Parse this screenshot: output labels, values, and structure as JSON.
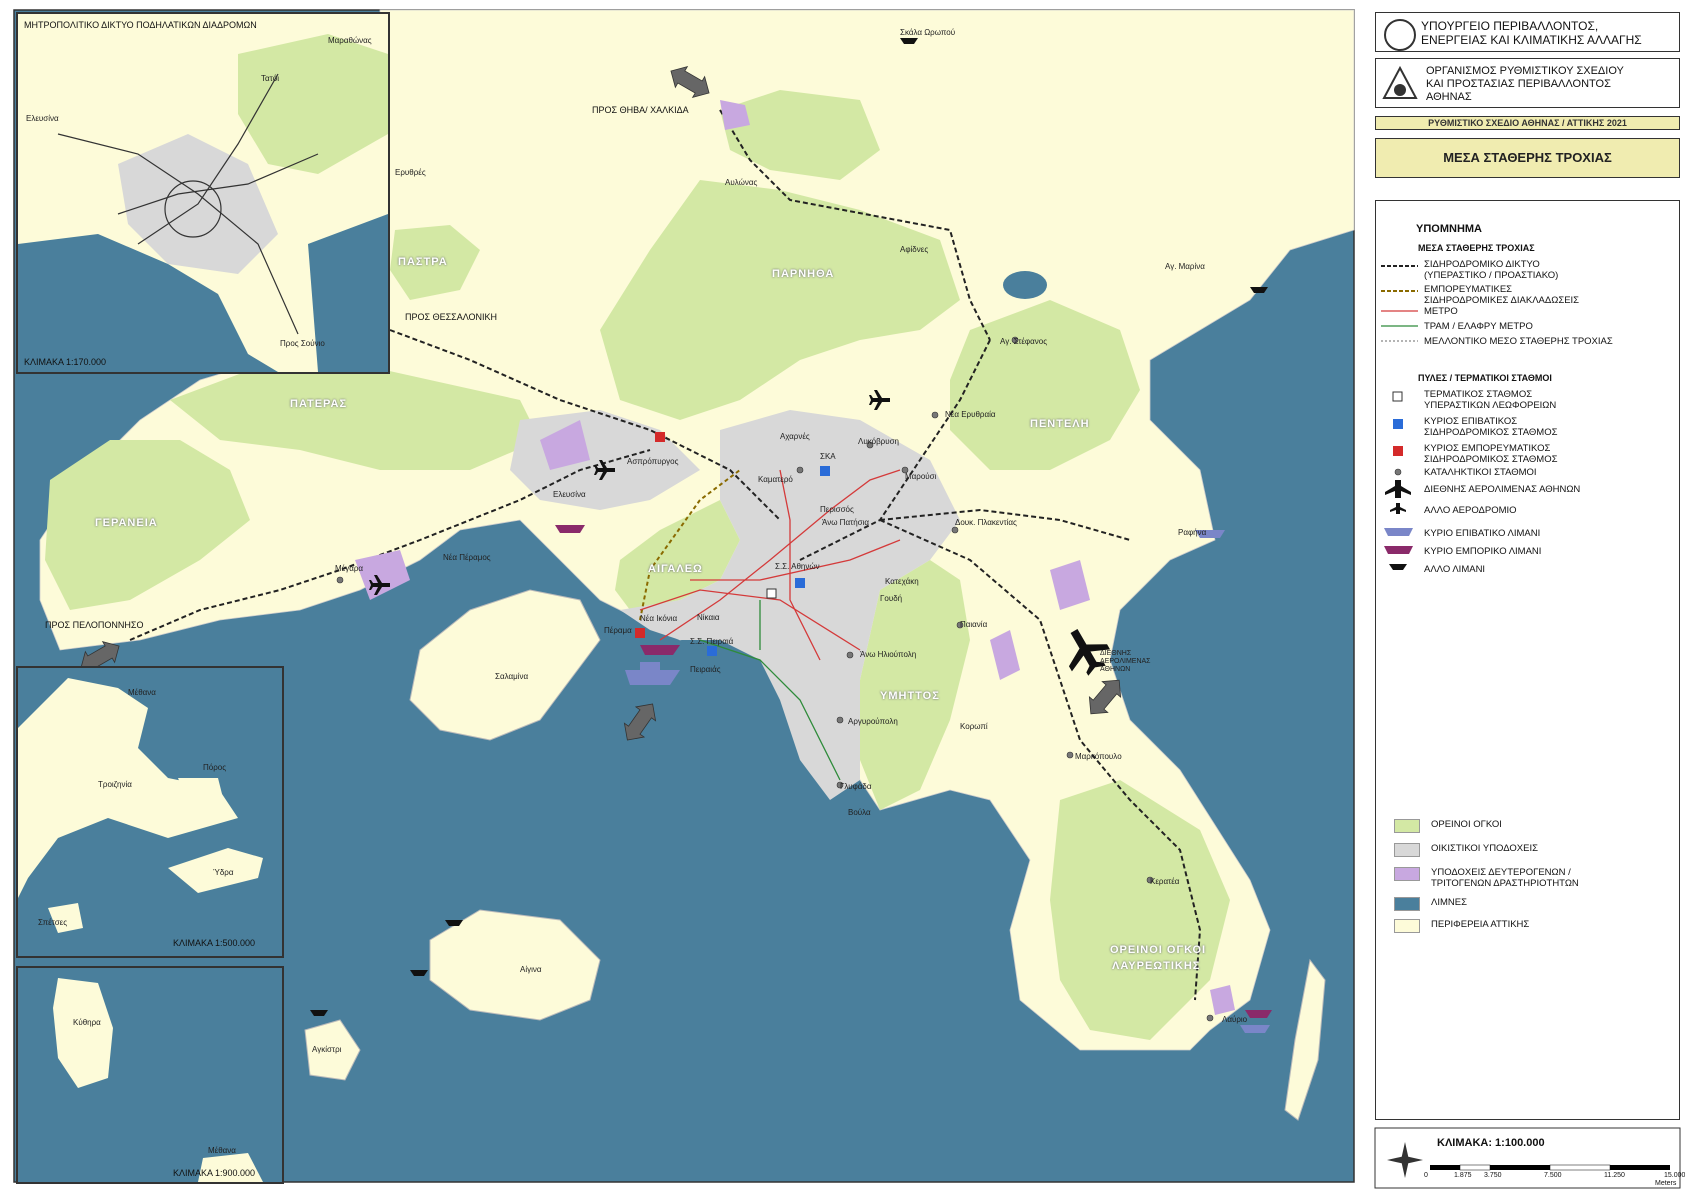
{
  "header": {
    "ministry": "ΥΠΟΥΡΓΕΙΟ ΠΕΡΙΒΑΛΛΟΝΤΟΣ,\nΕΝΕΡΓΕΙΑΣ ΚΑΙ ΚΛΙΜΑΤΙΚΗΣ ΑΛΛΑΓΗΣ",
    "organization": "ΟΡΓΑΝΙΣΜΟΣ ΡΥΘΜΙΣΤΙΚΟΥ ΣΧΕΔΙΟΥ\nΚΑΙ ΠΡΟΣΤΑΣΙΑΣ ΠΕΡΙΒΑΛΛΟΝΤΟΣ\nΑΘΗΝΑΣ",
    "plan": "ΡΥΘΜΙΣΤΙΚΟ ΣΧΕΔΙΟ ΑΘΗΝΑΣ / ΑΤΤΙΚΗΣ 2021",
    "map_title": "ΜΕΣΑ ΣΤΑΘΕΡΗΣ ΤΡΟΧΙΑΣ"
  },
  "legend": {
    "title": "ΥΠΟΜΝΗΜΑ",
    "section_rail": "ΜΕΣΑ ΣΤΑΘΕΡΗΣ ΤΡΟΧΙΑΣ",
    "rail_items": [
      "ΣΙΔΗΡΟΔΡΟΜΙΚΟ ΔΙΚΤΥΟ\n(ΥΠΕΡΑΣΤΙΚΟ / ΠΡΟΑΣΤΙΑΚΟ)",
      "ΕΜΠΟΡΕΥΜΑΤΙΚΕΣ\nΣΙΔΗΡΟΔΡΟΜΙΚΕΣ ΔΙΑΚΛΑΔΩΣΕΙΣ",
      "ΜΕΤΡΟ",
      "ΤΡΑΜ / ΕΛΑΦΡΥ ΜΕΤΡΟ",
      "ΜΕΛΛΟΝΤΙΚΟ ΜΕΣΟ ΣΤΑΘΕΡΗΣ ΤΡΟΧΙΑΣ"
    ],
    "section_gates": "ΠΥΛΕΣ / ΤΕΡΜΑΤΙΚΟΙ ΣΤΑΘΜΟΙ",
    "gate_items": [
      "ΤΕΡΜΑΤΙΚΟΣ ΣΤΑΘΜΟΣ\nΥΠΕΡΑΣΤΙΚΩΝ ΛΕΩΦΟΡΕΙΩΝ",
      "ΚΥΡΙΟΣ ΕΠΙΒΑΤΙΚΟΣ\nΣΙΔΗΡΟΔΡΟΜΙΚΟΣ ΣΤΑΘΜΟΣ",
      "ΚΥΡΙΟΣ ΕΜΠΟΡΕΥΜΑΤΙΚΟΣ\nΣΙΔΗΡΟΔΡΟΜΙΚΟΣ ΣΤΑΘΜΟΣ",
      "ΚΑΤΑΛΗΚΤΙΚΟΙ ΣΤΑΘΜΟΙ",
      "ΔΙΕΘΝΗΣ ΑΕΡΟΛΙΜΕΝΑΣ ΑΘΗΝΩΝ",
      "ΑΛΛΟ ΑΕΡΟΔΡΟΜΙΟ",
      "ΚΥΡΙΟ ΕΠΙΒΑΤΙΚΟ ΛΙΜΑΝΙ",
      "ΚΥΡΙΟ ΕΜΠΟΡΙΚΟ ΛΙΜΑΝΙ",
      "ΑΛΛΟ ΛΙΜΑΝΙ"
    ],
    "area_items": [
      {
        "label": "ΟΡΕΙΝΟΙ ΟΓΚΟΙ",
        "color": "#d3e8a4"
      },
      {
        "label": "ΟΙΚΙΣΤΙΚΟΙ ΥΠΟΔΟΧΕΙΣ",
        "color": "#d8d8d8"
      },
      {
        "label": "ΥΠΟΔΟΧΕΙΣ ΔΕΥΤΕΡΟΓΕΝΩΝ /\nΤΡΙΤΟΓΕΝΩΝ ΔΡΑΣΤΗΡΙΟΤΗΤΩΝ",
        "color": "#c8a8e0"
      },
      {
        "label": "ΛΙΜΝΕΣ",
        "color": "#4a7f9c"
      },
      {
        "label": "ΠΕΡΙΦΕΡΕΙΑ ΑΤΤΙΚΗΣ",
        "color": "#fdfbd9"
      }
    ]
  },
  "scale": {
    "label": "ΚΛΙΜΑΚΑ: 1:100.000",
    "ticks": [
      "0",
      "1.875",
      "3.750",
      "7.500",
      "11.250",
      "15.000"
    ],
    "unit": "Meters"
  },
  "insets": {
    "top": {
      "title": "ΜΗΤΡΟΠΟΛΙΤΙΚΟ ΔΙΚΤΥΟ ΠΟΔΗΛΑΤΙΚΩΝ ΔΙΑΔΡΟΜΩΝ",
      "scale": "ΚΛΙΜΑΚΑ 1:170.000",
      "places": [
        "Μαραθώνας",
        "Τατόι",
        "Ελευσίνα",
        "Ερυθρές",
        "Προς Σούνιο"
      ]
    },
    "middle": {
      "scale": "ΚΛΙΜΑΚΑ 1:500.000",
      "places": [
        "Μέθανα",
        "Πόρος",
        "Τροιζηνία",
        "Ύδρα",
        "Σπέτσες"
      ]
    },
    "bottom": {
      "scale": "ΚΛΙΜΑΚΑ 1:900.000",
      "places": [
        "Κύθηρα",
        "Μέθανα"
      ]
    }
  },
  "mountains": [
    "ΠΑΣΤΡΑ",
    "ΠΑΡΝΗΘΑ",
    "ΠΑΤΕΡΑΣ",
    "ΠΕΝΤΕΛΗ",
    "ΓΕΡΑΝΕΙΑ",
    "ΑΙΓΑΛΕΩ",
    "ΥΜΗΤΤΟΣ",
    "ΟΡΕΙΝΟΙ ΟΓΚΟΙ",
    "ΛΑΥΡΕΩΤΙΚΗΣ"
  ],
  "directions": [
    "ΠΡΟΣ ΘΗΒΑ/ ΧΑΛΚΙΔΑ",
    "ΠΡΟΣ ΘΕΣΣΑΛΟΝΙΚΗ",
    "ΠΡΟΣ ΠΕΛΟΠΟΝΝΗΣΟ"
  ],
  "places": [
    "Σκάλα Ωρωπού",
    "Αυλώνας",
    "Αφίδνες",
    "Αγ. Μαρίνα",
    "Αγ. Στέφανος",
    "Νέα Ερυθραία",
    "Λυκόβρυση",
    "Αχαρνές",
    "ΣΚΑ",
    "Ασπρόπυργος",
    "Καματερό",
    "Περισσός",
    "Άνω Πατήσια",
    "Μαρούσι",
    "Δουκ. Πλακεντίας",
    "Ραφήνα",
    "Ελευσίνα",
    "Μέγαρα",
    "Νέα Πέραμος",
    "Σ.Σ. Αθηνών",
    "Κατεχάκη",
    "Γουδή",
    "Παιανία",
    "Πέραμα",
    "Νέα Ικόνια",
    "Νίκαια",
    "Σ.Σ. Πειραιά",
    "Πειραιάς",
    "Άνω Ηλιούπολη",
    "Σαλαμίνα",
    "ΔΙΕΘΝΗΣ\nΑΕΡΟΛΙΜΕΝΑΣ\nΑΘΗΝΩΝ",
    "Αργυρούπολη",
    "Κορωπί",
    "Μαρκόπουλο",
    "Γλυφάδα",
    "Βούλα",
    "Κερατέα",
    "Λαύριο",
    "Αίγινα",
    "Αγκίστρι"
  ]
}
